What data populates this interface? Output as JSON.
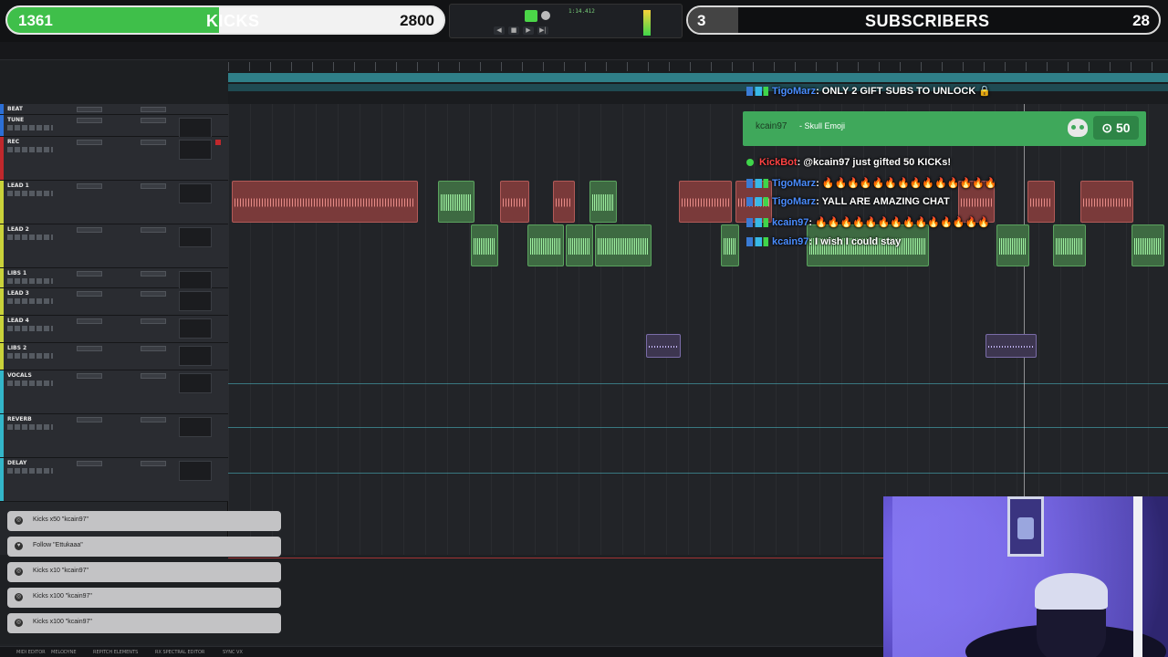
{
  "overlay": {
    "kicks": {
      "count": "1361",
      "label": "KICKS",
      "goal": "2800",
      "progress": 0.486
    },
    "subs": {
      "count": "3",
      "label": "SUBSCRIBERS",
      "goal": "28",
      "progress": 0.107
    },
    "transport": {
      "timecode": "1:14.412"
    }
  },
  "chat": {
    "pinned": {
      "user": "TigoMarz",
      "message": ": ONLY 2 GIFT SUBS TO UNLOCK 🔒"
    },
    "reward": {
      "user": "kcain97",
      "text": "- Skull Emoji",
      "cost": "50",
      "cost_icon": "coin-icon"
    },
    "system": {
      "user": "KickBot",
      "message": ": @kcain97 just gifted 50 KICKs!"
    },
    "messages": [
      {
        "user": "TigoMarz",
        "message": ": 🔥🔥🔥🔥🔥🔥🔥🔥🔥🔥🔥🔥🔥🔥"
      },
      {
        "user": "TigoMarz",
        "message": ": YALL ARE AMAZING CHAT"
      },
      {
        "user": "kcain97",
        "message": ": 🔥🔥🔥🔥🔥🔥🔥🔥🔥🔥🔥🔥🔥🔥"
      },
      {
        "user": "kcain97",
        "message": ": I wish I could stay"
      }
    ]
  },
  "tracks": [
    {
      "name": "BEAT",
      "color": "#2c6fd6"
    },
    {
      "name": "TUNE",
      "color": "#2c6fd6"
    },
    {
      "name": "REC",
      "color": "#c0282c"
    },
    {
      "name": "LEAD 1",
      "color": "#c9d23a"
    },
    {
      "name": "LEAD 2",
      "color": "#c9d23a"
    },
    {
      "name": "LIBS 1",
      "color": "#c9d23a"
    },
    {
      "name": "LEAD 3",
      "color": "#c9d23a"
    },
    {
      "name": "LEAD 4",
      "color": "#c9d23a"
    },
    {
      "name": "LIBS 2",
      "color": "#c9d23a"
    },
    {
      "name": "VOCALS",
      "color": "#33b6c9"
    },
    {
      "name": "REVERB",
      "color": "#33b6c9"
    },
    {
      "name": "DELAY",
      "color": "#33b6c9"
    }
  ],
  "events": [
    {
      "icon": "kick-icon",
      "text": "Kicks x50 \"kcain97\""
    },
    {
      "icon": "heart-icon",
      "text": "Follow \"Ettukaaa\""
    },
    {
      "icon": "kick-icon",
      "text": "Kicks x10 \"kcain97\""
    },
    {
      "icon": "kick-icon",
      "text": "Kicks x100 \"kcain97\""
    },
    {
      "icon": "kick-icon",
      "text": "Kicks x100 \"kcain97\""
    }
  ],
  "statusbar": [
    "MIDI EDITOR",
    "MELODYNE",
    "REPITCH ELEMENTS",
    "RX SPECTRAL EDITOR",
    "SYNC VX"
  ]
}
